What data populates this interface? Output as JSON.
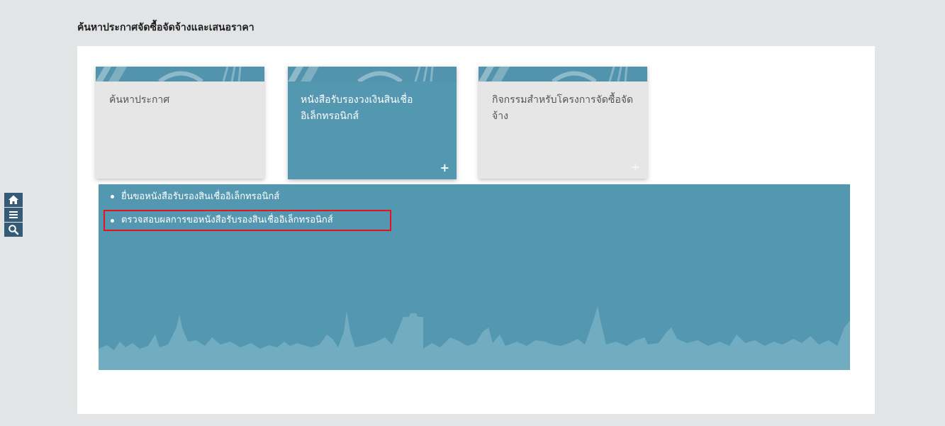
{
  "page": {
    "title": "ค้นหาประกาศจัดซื้อจัดจ้างและเสนอราคา"
  },
  "toolbar": {
    "icons": [
      "home-icon",
      "menu-icon",
      "search-icon"
    ]
  },
  "tiles": [
    {
      "label": "ค้นหาประกาศ",
      "state": "normal"
    },
    {
      "label": "หนังสือรับรองวงเงินสินเชื่ออิเล็กทรอนิกส์",
      "state": "active",
      "plus": "+"
    },
    {
      "label": "กิจกรรมสำหรับโครงการจัดซื้อจัดจ้าง",
      "state": "normal",
      "plus": "+"
    }
  ],
  "submenu": {
    "items": [
      {
        "label": "ยื่นขอหนังสือรับรองสินเชื่ออิเล็กทรอนิกส์",
        "highlighted": false
      },
      {
        "label": "ตรวจสอบผลการขอหนังสือรับรองสินเชื่ออิเล็กทรอนิกส์",
        "highlighted": true
      }
    ]
  },
  "colors": {
    "accent": "#5497b0",
    "toolbar": "#365b76",
    "highlight_border": "#e8121c",
    "tile_light": "#e6e6e6"
  }
}
